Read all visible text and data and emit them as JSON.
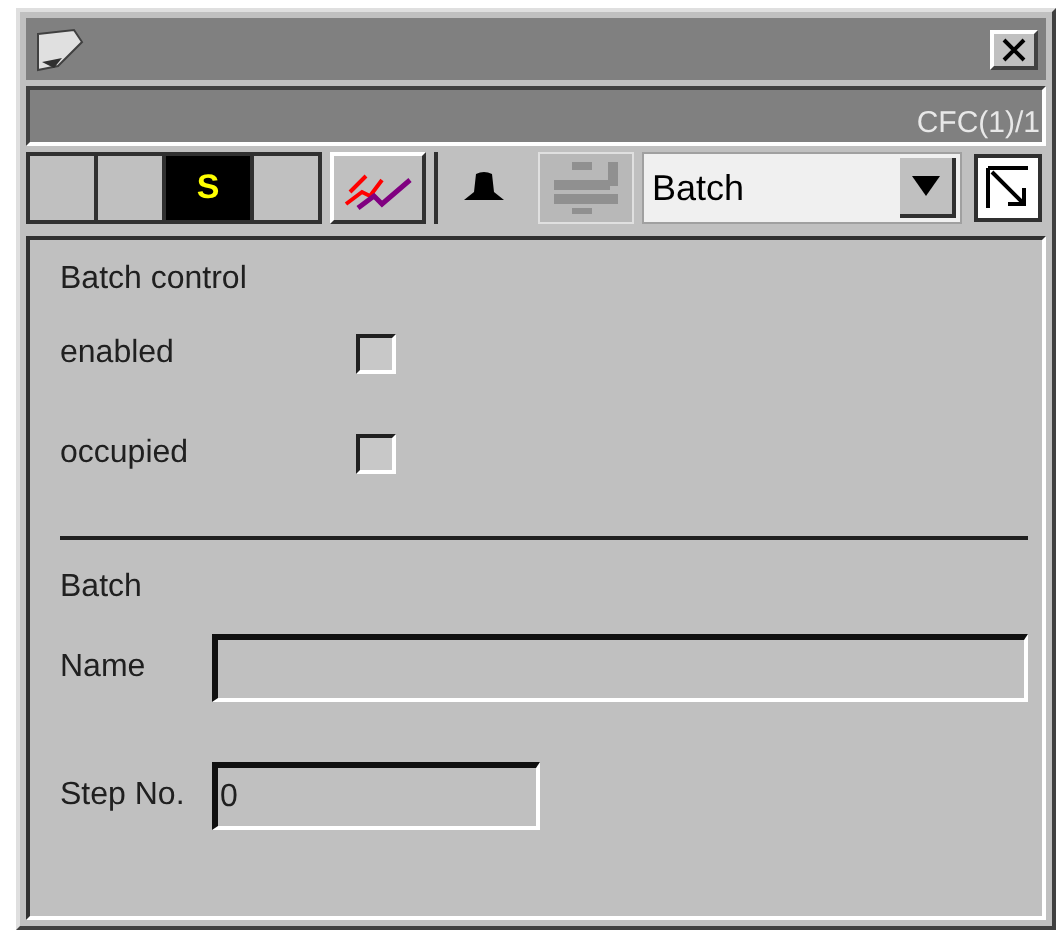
{
  "header": {
    "title": "CFC(1)/1"
  },
  "status_cells": [
    {
      "kind": "blank"
    },
    {
      "kind": "blank"
    },
    {
      "kind": "letter",
      "label": "S"
    },
    {
      "kind": "blank"
    }
  ],
  "toolbar": {
    "dropdown": {
      "value": "Batch"
    }
  },
  "section_1": {
    "heading": "Batch control",
    "checkboxes": [
      {
        "label": "enabled",
        "checked": false
      },
      {
        "label": "occupied",
        "checked": false
      }
    ]
  },
  "section_2": {
    "heading": "Batch",
    "fields": [
      {
        "label": "Name",
        "kind": "wide"
      },
      {
        "label": "Step No.",
        "value": "0",
        "kind": "narrow"
      }
    ]
  }
}
